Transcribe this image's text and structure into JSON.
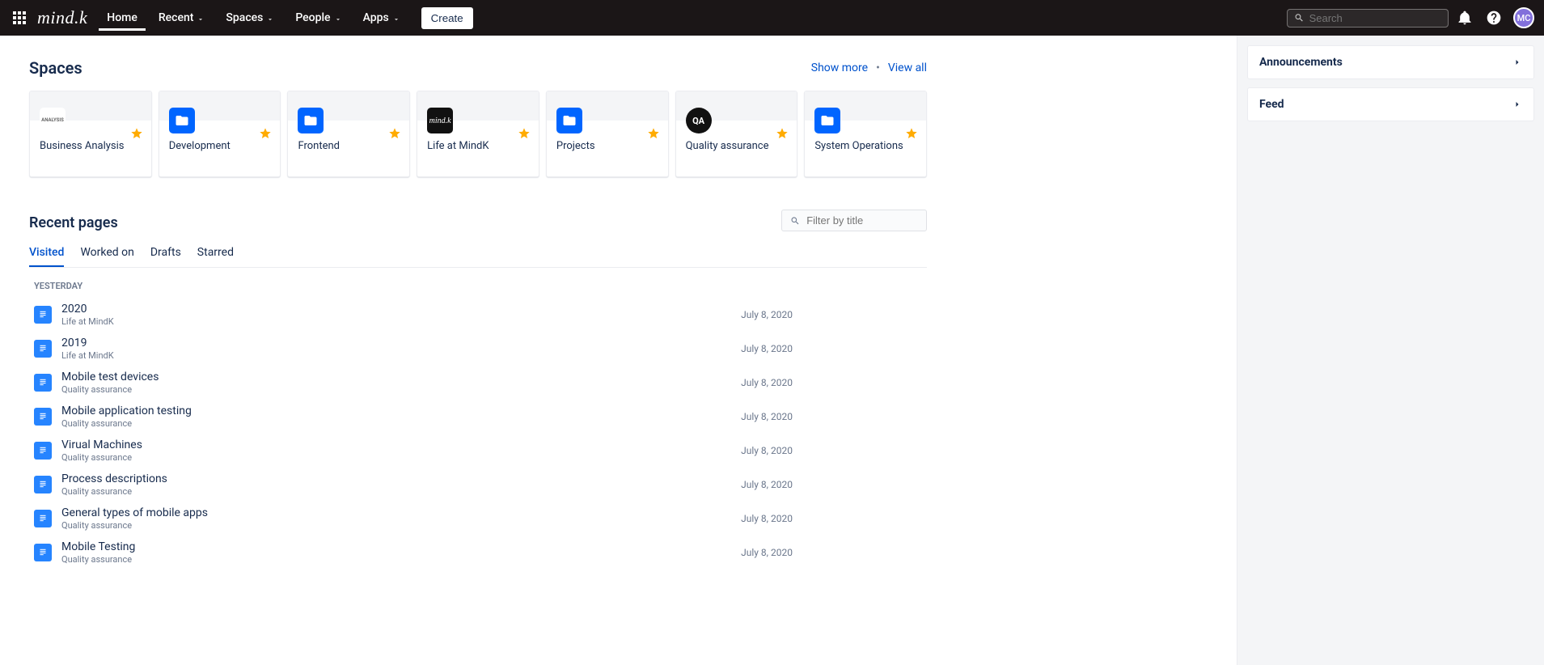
{
  "nav": {
    "logo": "mind.k",
    "home": "Home",
    "recent": "Recent",
    "spaces": "Spaces",
    "people": "People",
    "apps": "Apps",
    "create": "Create",
    "search_placeholder": "Search",
    "avatar_initials": "MC"
  },
  "spaces_section": {
    "title": "Spaces",
    "show_more": "Show more",
    "view_all": "View all",
    "cards": [
      {
        "name": "Business Analysis",
        "icon": "analysis"
      },
      {
        "name": "Development",
        "icon": "blue"
      },
      {
        "name": "Frontend",
        "icon": "blue"
      },
      {
        "name": "Life at MindK",
        "icon": "dark"
      },
      {
        "name": "Projects",
        "icon": "blue"
      },
      {
        "name": "Quality assurance",
        "icon": "qa"
      },
      {
        "name": "System Operations",
        "icon": "blue"
      }
    ]
  },
  "recent_section": {
    "title": "Recent pages",
    "filter_placeholder": "Filter by title",
    "tabs": {
      "visited": "Visited",
      "worked_on": "Worked on",
      "drafts": "Drafts",
      "starred": "Starred"
    },
    "group_label": "YESTERDAY",
    "pages": [
      {
        "title": "2020",
        "space": "Life at MindK",
        "date": "July 8, 2020"
      },
      {
        "title": "2019",
        "space": "Life at MindK",
        "date": "July 8, 2020"
      },
      {
        "title": "Mobile test devices",
        "space": "Quality assurance",
        "date": "July 8, 2020"
      },
      {
        "title": "Mobile application testing",
        "space": "Quality assurance",
        "date": "July 8, 2020"
      },
      {
        "title": "Virual Machines",
        "space": "Quality assurance",
        "date": "July 8, 2020"
      },
      {
        "title": "Process descriptions",
        "space": "Quality assurance",
        "date": "July 8, 2020"
      },
      {
        "title": "General types of mobile apps",
        "space": "Quality assurance",
        "date": "July 8, 2020"
      },
      {
        "title": "Mobile Testing",
        "space": "Quality assurance",
        "date": "July 8, 2020"
      }
    ]
  },
  "side": {
    "announcements": "Announcements",
    "feed": "Feed"
  }
}
